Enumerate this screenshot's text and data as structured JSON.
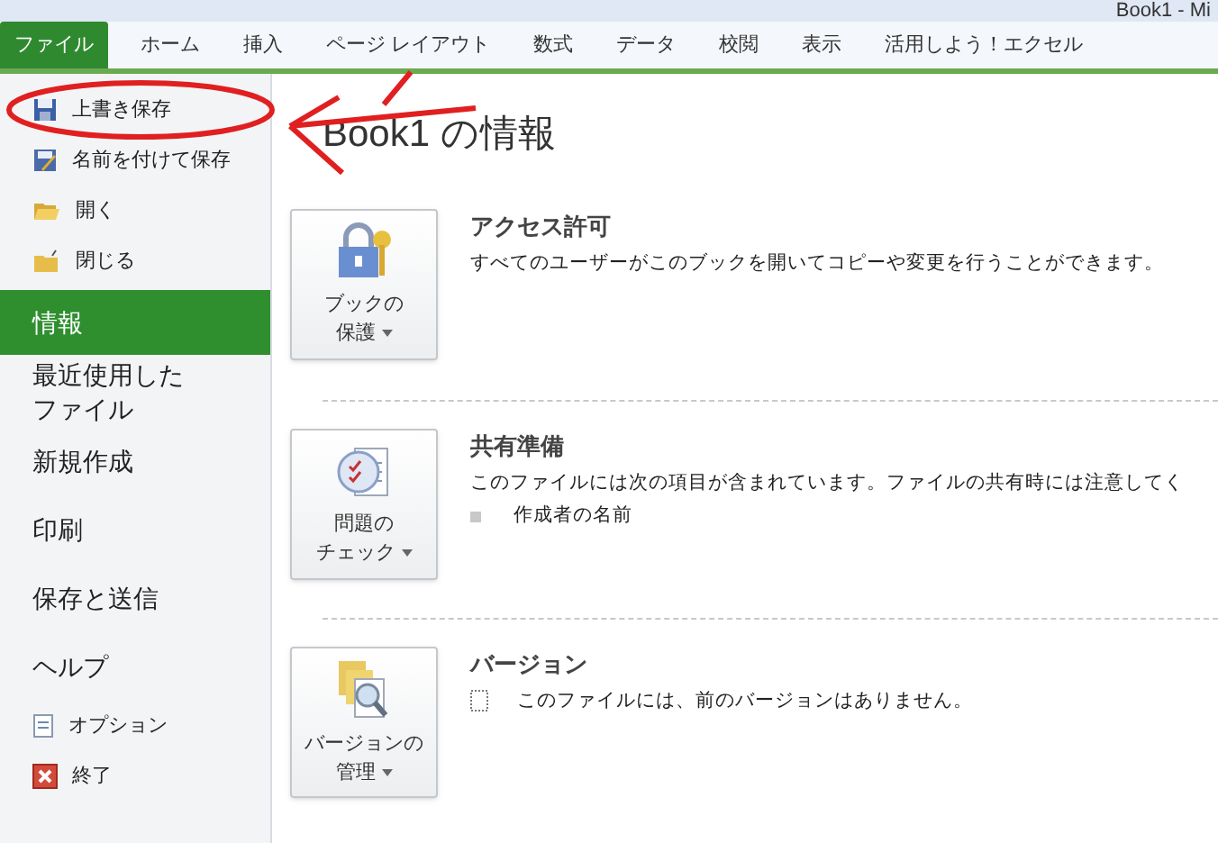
{
  "window": {
    "title": "Book1 - Mi"
  },
  "ribbon_tabs": [
    {
      "label": "ファイル",
      "selected": true
    },
    {
      "label": "ホーム",
      "selected": false
    },
    {
      "label": "挿入",
      "selected": false
    },
    {
      "label": "ページ レイアウト",
      "selected": false
    },
    {
      "label": "数式",
      "selected": false
    },
    {
      "label": "データ",
      "selected": false
    },
    {
      "label": "校閲",
      "selected": false
    },
    {
      "label": "表示",
      "selected": false
    },
    {
      "label": "活用しよう！エクセル",
      "selected": false
    }
  ],
  "sidebar": {
    "items": [
      {
        "kind": "command",
        "label": "上書き保存",
        "selected": false
      },
      {
        "kind": "command",
        "label": "名前を付けて保存",
        "selected": false
      },
      {
        "kind": "command",
        "label": "開く",
        "selected": false
      },
      {
        "kind": "command",
        "label": "閉じる",
        "selected": false
      },
      {
        "kind": "tab",
        "label": "情報",
        "selected": true
      },
      {
        "kind": "tab",
        "label": "最近使用したファイル",
        "selected": false
      },
      {
        "kind": "tab",
        "label": "新規作成",
        "selected": false
      },
      {
        "kind": "tab",
        "label": "印刷",
        "selected": false
      },
      {
        "kind": "tab",
        "label": "保存と送信",
        "selected": false
      },
      {
        "kind": "tab",
        "label": "ヘルプ",
        "selected": false
      },
      {
        "kind": "command",
        "label": "オプション",
        "selected": false
      },
      {
        "kind": "command",
        "label": "終了",
        "selected": false
      }
    ]
  },
  "info": {
    "heading": "Book1 の情報",
    "sections": [
      {
        "button": [
          "ブックの",
          "保護"
        ],
        "title": "アクセス許可",
        "text": "すべてのユーザーがこのブックを開いてコピーや変更を行うことができます。"
      },
      {
        "button": [
          "問題の",
          "チェック"
        ],
        "title": "共有準備",
        "text": "このファイルには次の項目が含まれています。ファイルの共有時には注意してく",
        "bullets": [
          "作成者の名前"
        ]
      },
      {
        "button": [
          "バージョンの",
          "管理"
        ],
        "title": "バージョン",
        "note": "このファイルには、前のバージョンはありません。"
      }
    ]
  }
}
